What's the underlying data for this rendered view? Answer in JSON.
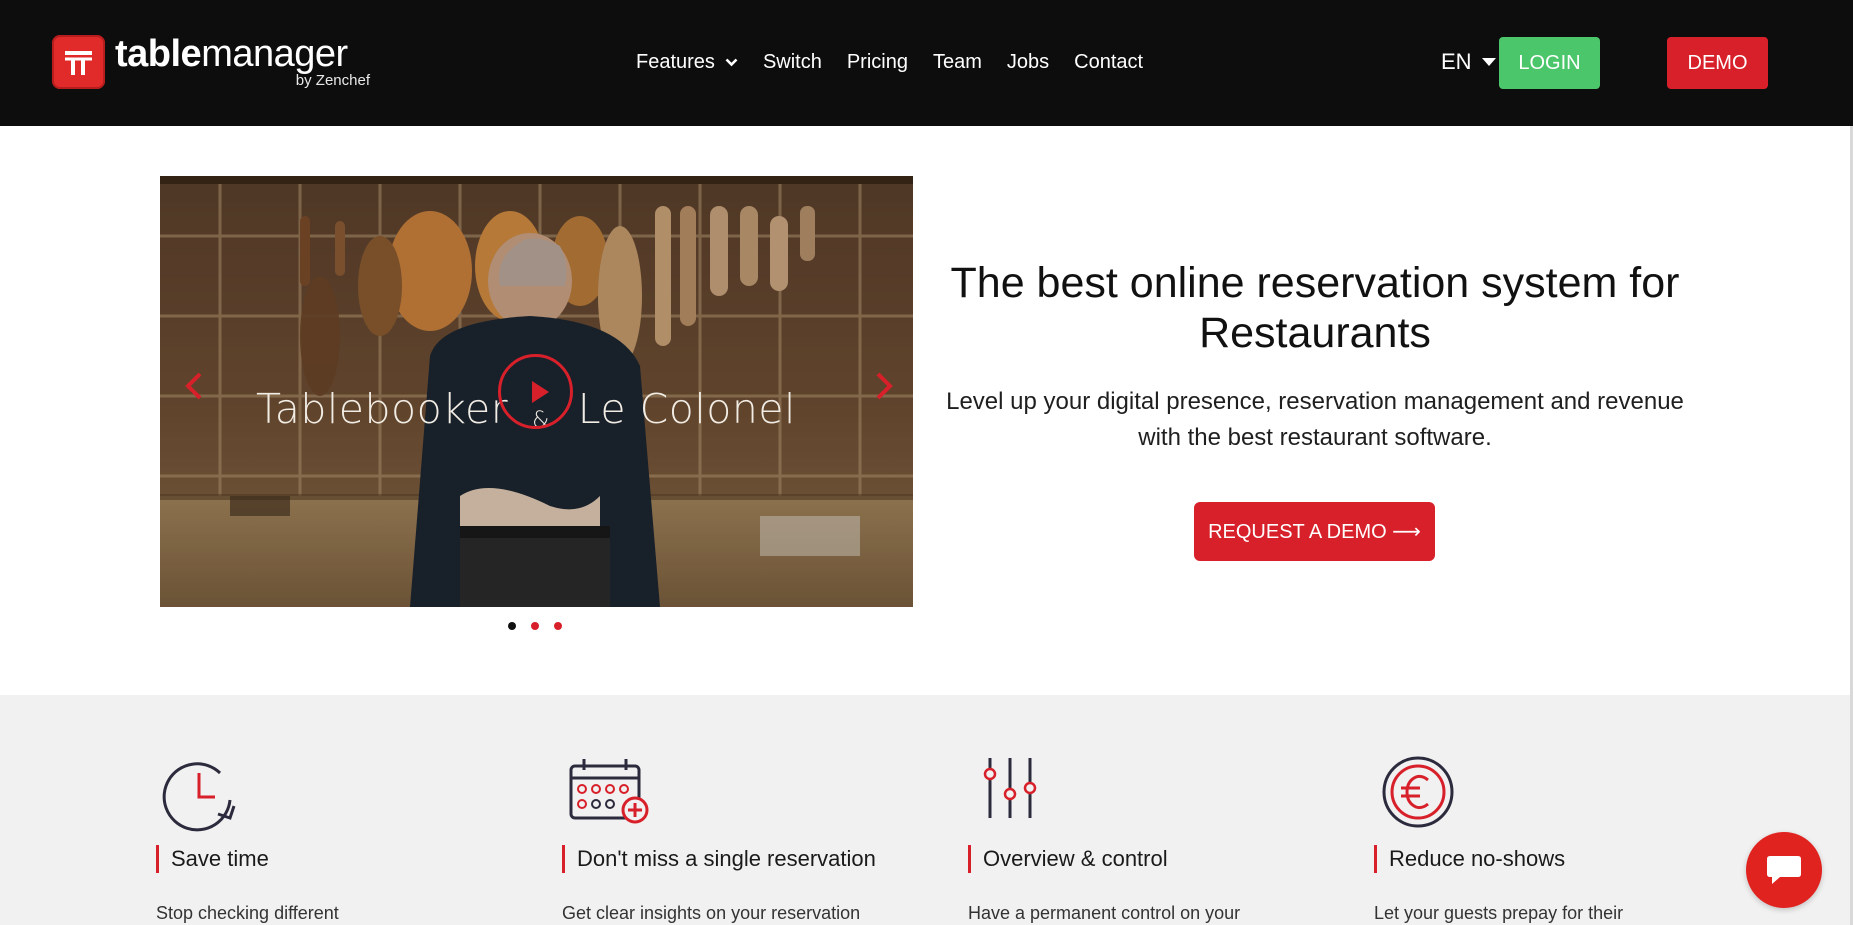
{
  "brand": {
    "name_bold": "table",
    "name_light": "manager",
    "byline": "by Zenchef",
    "color": "#e12a2a"
  },
  "nav": {
    "items": [
      {
        "label": "Features",
        "has_dropdown": true
      },
      {
        "label": "Switch"
      },
      {
        "label": "Pricing"
      },
      {
        "label": "Team"
      },
      {
        "label": "Jobs"
      },
      {
        "label": "Contact"
      }
    ],
    "language": "EN",
    "login_label": "LOGIN",
    "demo_label": "DEMO",
    "login_color": "#4cc66a",
    "demo_color": "#d8202a"
  },
  "hero": {
    "video_caption_left": "Tablebooker",
    "video_caption_amp": "&",
    "video_caption_right": "Le Colonel",
    "title": "The best online reservation system for Restaurants",
    "subtitle": "Level up your digital presence, reservation management and revenue with the best restaurant software.",
    "cta_label": "REQUEST A DEMO ⟶",
    "carousel": {
      "slides": 3,
      "active_index": 0,
      "active_color": "#111111",
      "inactive_color": "#d8202a"
    }
  },
  "features": [
    {
      "icon": "clock-refresh-icon",
      "title": "Save time",
      "desc": "Stop checking different"
    },
    {
      "icon": "calendar-add-icon",
      "title": "Don't miss a single reservation",
      "desc": "Get clear insights on your reservation"
    },
    {
      "icon": "sliders-icon",
      "title": "Overview & control",
      "desc": "Have a permanent control on your"
    },
    {
      "icon": "euro-coin-icon",
      "title": "Reduce no-shows",
      "desc": "Let your guests prepay for their"
    }
  ],
  "chat": {
    "icon": "chat-bubble-icon"
  }
}
